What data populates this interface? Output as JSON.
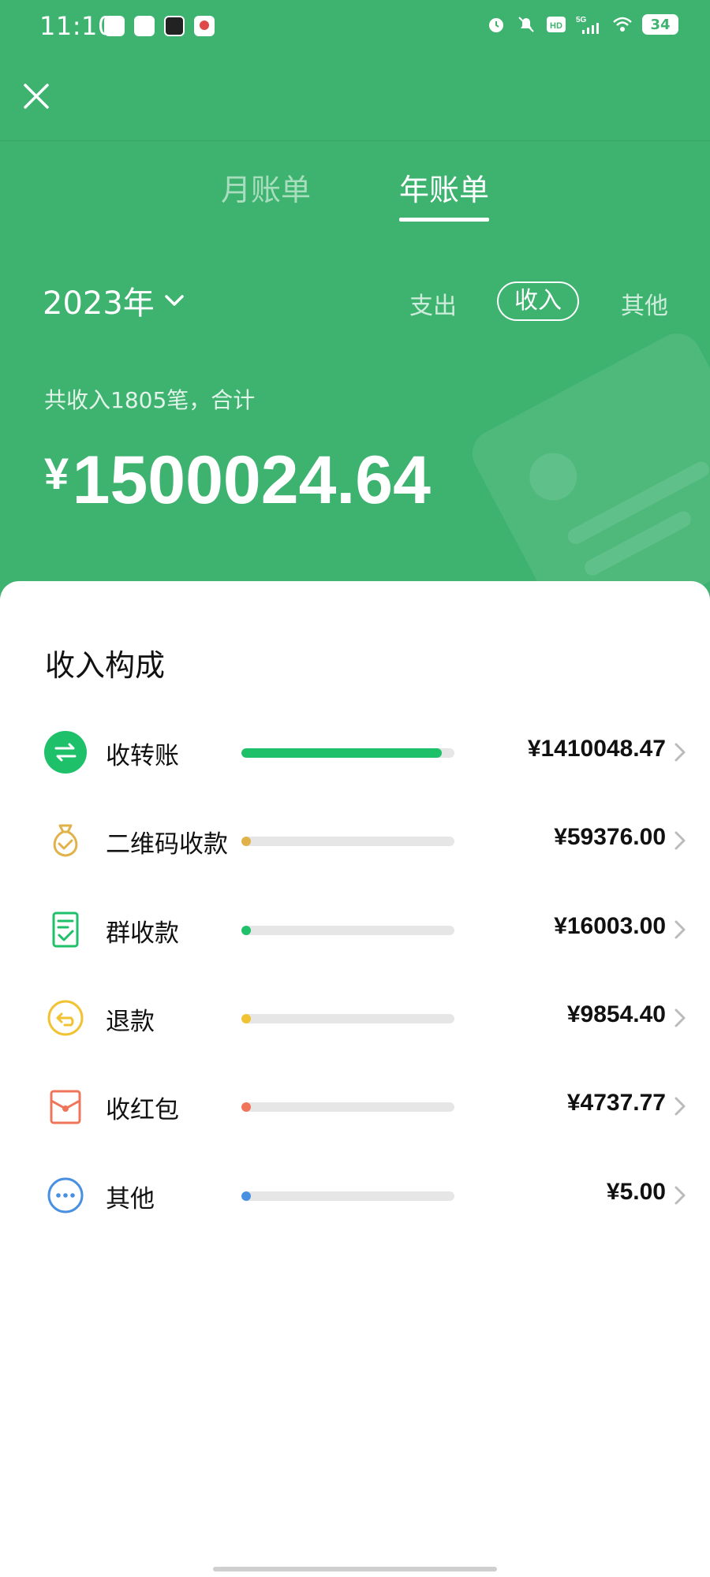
{
  "status_bar": {
    "time": "11:10",
    "signal_label": "5G",
    "hd_label": "HD",
    "battery": "34"
  },
  "tabs": [
    {
      "label": "月账单",
      "active": false
    },
    {
      "label": "年账单",
      "active": true
    }
  ],
  "year_selector": {
    "value": "2023年"
  },
  "filters": [
    {
      "label": "支出",
      "selected": false
    },
    {
      "label": "收入",
      "selected": true
    },
    {
      "label": "其他",
      "selected": false
    }
  ],
  "summary": {
    "label": "共收入1805笔，合计",
    "currency": "¥",
    "amount": "1500024.64"
  },
  "breakdown": {
    "title": "收入构成",
    "items": [
      {
        "label": "收转账",
        "amount": "¥1410048.47",
        "share": 0.94,
        "color": "#1fc06a",
        "icon": "transfer-icon"
      },
      {
        "label": "二维码收款",
        "amount": "¥59376.00",
        "share": 0.04,
        "color": "#e2b24a",
        "icon": "money-bag-icon"
      },
      {
        "label": "群收款",
        "amount": "¥16003.00",
        "share": 0.011,
        "color": "#1fc06a",
        "icon": "receipt-check-icon"
      },
      {
        "label": "退款",
        "amount": "¥9854.40",
        "share": 0.007,
        "color": "#f1c232",
        "icon": "refund-icon"
      },
      {
        "label": "收红包",
        "amount": "¥4737.77",
        "share": 0.003,
        "color": "#f0745a",
        "icon": "red-packet-icon"
      },
      {
        "label": "其他",
        "amount": "¥5.00",
        "share": 0.0,
        "color": "#4a90e2",
        "icon": "more-icon"
      }
    ]
  },
  "colors": {
    "header_green": "#3eb370",
    "panel_bg": "#ffffff"
  }
}
